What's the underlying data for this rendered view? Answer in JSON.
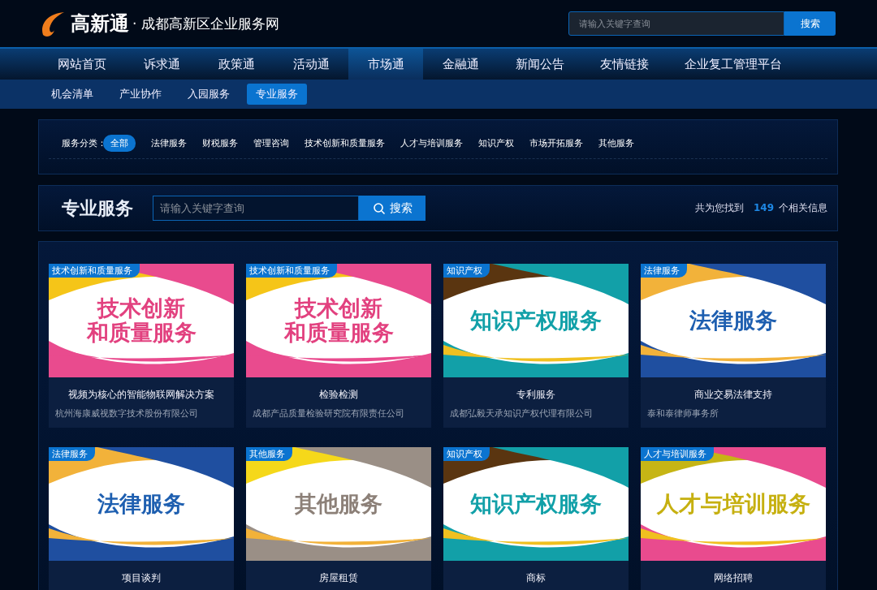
{
  "header": {
    "logo_text": "高新通",
    "site_name": "· 成都高新区企业服务网",
    "search": {
      "placeholder": "请输入关键字查询",
      "button": "搜索"
    }
  },
  "nav": [
    {
      "label": "网站首页",
      "selected": false
    },
    {
      "label": "诉求通",
      "selected": false
    },
    {
      "label": "政策通",
      "selected": false
    },
    {
      "label": "活动通",
      "selected": false
    },
    {
      "label": "市场通",
      "selected": true
    },
    {
      "label": "金融通",
      "selected": false
    },
    {
      "label": "新闻公告",
      "selected": false
    },
    {
      "label": "友情链接",
      "selected": false
    },
    {
      "label": "企业复工管理平台",
      "selected": false
    }
  ],
  "subnav": [
    {
      "label": "机会清单",
      "selected": false
    },
    {
      "label": "产业协作",
      "selected": false
    },
    {
      "label": "入园服务",
      "selected": false
    },
    {
      "label": "专业服务",
      "selected": true
    }
  ],
  "filter": {
    "label": "服务分类：",
    "options": [
      {
        "label": "全部",
        "selected": true
      },
      {
        "label": "法律服务",
        "selected": false
      },
      {
        "label": "财税服务",
        "selected": false
      },
      {
        "label": "管理咨询",
        "selected": false
      },
      {
        "label": "技术创新和质量服务",
        "selected": false
      },
      {
        "label": "人才与培训服务",
        "selected": false
      },
      {
        "label": "知识产权",
        "selected": false
      },
      {
        "label": "市场开拓服务",
        "selected": false
      },
      {
        "label": "其他服务",
        "selected": false
      }
    ]
  },
  "section": {
    "title": "专业服务",
    "search": {
      "placeholder": "请输入关键字查询",
      "button": "搜索"
    },
    "result_prefix": "共为您找到",
    "result_count": "149",
    "result_suffix": "个相关信息"
  },
  "cards": [
    {
      "kind": "tech",
      "tag": "技术创新和质量服务",
      "banner_lines": [
        "技术创新",
        "和质量服务"
      ],
      "title": "视频为核心的智能物联网解决方案",
      "company": "杭州海康威视数字技术股份有限公司"
    },
    {
      "kind": "tech",
      "tag": "技术创新和质量服务",
      "banner_lines": [
        "技术创新",
        "和质量服务"
      ],
      "title": "检验检测",
      "company": "成都产品质量检验研究院有限责任公司"
    },
    {
      "kind": "ip",
      "tag": "知识产权",
      "banner_lines": [
        "知识产权服务"
      ],
      "title": "专利服务",
      "company": "成都弘毅天承知识产权代理有限公司"
    },
    {
      "kind": "law",
      "tag": "法律服务",
      "banner_lines": [
        "法律服务"
      ],
      "title": "商业交易法律支持",
      "company": "泰和泰律师事务所"
    },
    {
      "kind": "law",
      "tag": "法律服务",
      "banner_lines": [
        "法律服务"
      ],
      "title": "项目谈判"
    },
    {
      "kind": "other",
      "tag": "其他服务",
      "banner_lines": [
        "其他服务"
      ],
      "title": "房屋租赁"
    },
    {
      "kind": "ip",
      "tag": "知识产权",
      "banner_lines": [
        "知识产权服务"
      ],
      "title": "商标"
    },
    {
      "kind": "talent",
      "tag": "人才与培训服务",
      "banner_lines": [
        "人才与培训服务"
      ],
      "title": "网络招聘"
    }
  ]
}
